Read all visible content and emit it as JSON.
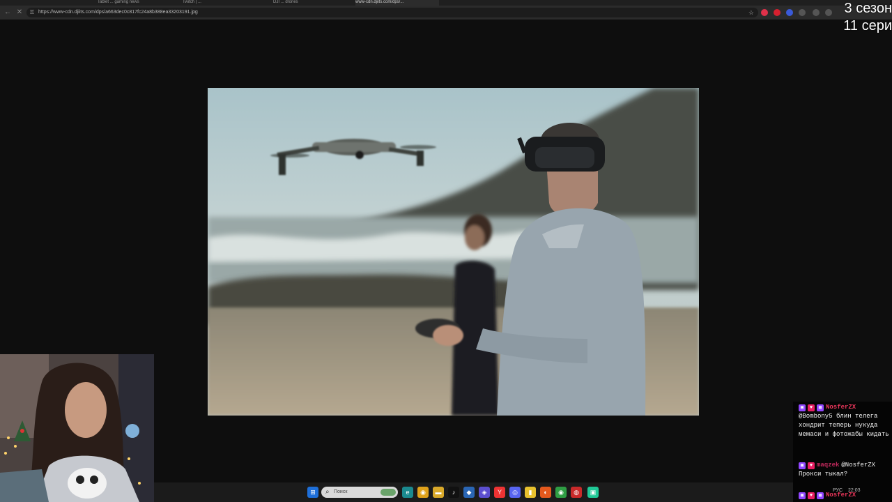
{
  "browser": {
    "tabs": [
      {
        "title": "",
        "active": false
      },
      {
        "title": "Tablet ... gaming news",
        "active": false
      },
      {
        "title": "Twitch | ...",
        "active": false
      },
      {
        "title": "DJI ... drones",
        "active": false
      },
      {
        "title": "www-cdn.djiits.com/dps/...",
        "active": true
      }
    ],
    "url": "https://www-cdn.djiits.com/dps/a663dec0c817fc24a8b388ea33203191.jpg",
    "icons": [
      "back-icon",
      "reload-icon",
      "lock-icon",
      "star-icon"
    ],
    "extension_colors": [
      "#e0314a",
      "#d6202f",
      "#3a5ad9",
      "#8a8a8a"
    ]
  },
  "overlay": {
    "season": "3 сезон",
    "episode": "11 сери"
  },
  "chat": {
    "messages": [
      {
        "user": "NosferZX",
        "text": "@Bombony5 блин телега хондрит теперь нукуда мемаси и фотожабы кидать"
      },
      {
        "user": "maqzek",
        "mention": "@NosferZX",
        "text": "Прокси тыкал?"
      },
      {
        "user": "NosferZX",
        "text": ""
      }
    ],
    "badge_colors": [
      "#9146ff",
      "#e91e63"
    ]
  },
  "taskbar": {
    "search_placeholder": "Поиск",
    "tray_lang": "РУС",
    "tray_time": "22:03"
  },
  "colors": {
    "accent_twitch": "#9146ff",
    "username_red": "#e8365a"
  }
}
